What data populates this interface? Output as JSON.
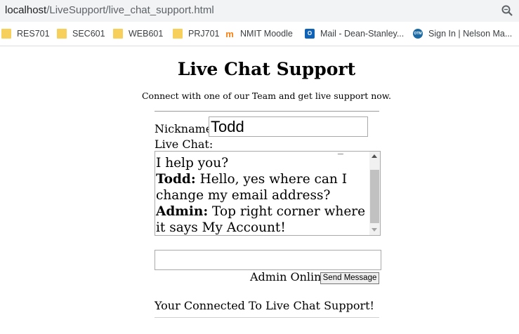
{
  "browser": {
    "url_host": "localhost",
    "url_path": "/LiveSupport/live_chat_support.html",
    "bookmarks": [
      {
        "label": "RES701",
        "icon": "folder-icon"
      },
      {
        "label": "SEC601",
        "icon": "folder-icon"
      },
      {
        "label": "WEB601",
        "icon": "folder-icon"
      },
      {
        "label": "PRJ701",
        "icon": "folder-icon"
      },
      {
        "label": "NMIT Moodle",
        "icon": "moodle-icon"
      },
      {
        "label": "Mail - Dean-Stanley...",
        "icon": "outlook-icon"
      },
      {
        "label": "Sign In | Nelson Ma...",
        "icon": "otm-icon"
      }
    ]
  },
  "page": {
    "title": "Live Chat Support",
    "subtitle": "Connect with one of our Team and get live support now.",
    "nickname_label": "Nickname:",
    "nickname_value": "Todd",
    "chat_label": "Live Chat:",
    "chat_lines": {
      "partial": "I help you?",
      "line1_user": "Todd:",
      "line1_text": " Hello, yes where can I change my email address?",
      "line2_user": "Admin:",
      "line2_text": " Top right corner where it says My Account!"
    },
    "message_value": "",
    "admin_status": "Admin Online",
    "send_label": "Send Message",
    "connection_status": "Your Connected To Live Chat Support!"
  }
}
